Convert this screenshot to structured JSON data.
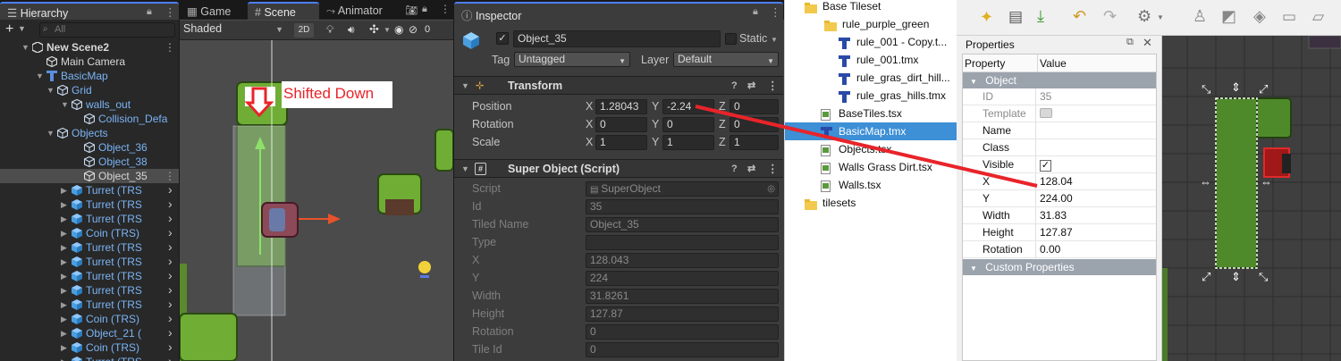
{
  "hierarchy": {
    "tab": "Hierarchy",
    "search_placeholder": "All",
    "rows": [
      {
        "label": "New Scene2"
      },
      {
        "label": "Main Camera"
      },
      {
        "label": "BasicMap"
      },
      {
        "label": "Grid"
      },
      {
        "label": "walls_out"
      },
      {
        "label": "Collision_Defa"
      },
      {
        "label": "Objects"
      },
      {
        "label": "Object_36"
      },
      {
        "label": "Object_38"
      },
      {
        "label": "Object_35"
      },
      {
        "label": "Turret (TRS"
      },
      {
        "label": "Turret (TRS"
      },
      {
        "label": "Turret (TRS"
      },
      {
        "label": "Coin (TRS)"
      },
      {
        "label": "Turret (TRS"
      },
      {
        "label": "Turret (TRS"
      },
      {
        "label": "Turret (TRS"
      },
      {
        "label": "Turret (TRS"
      },
      {
        "label": "Turret (TRS"
      },
      {
        "label": "Coin (TRS)"
      },
      {
        "label": "Object_21 ("
      },
      {
        "label": "Coin (TRS)"
      },
      {
        "label": "Turret (TRS"
      }
    ]
  },
  "scene": {
    "tabs": [
      "Game",
      "Scene",
      "Animator"
    ],
    "shading_mode": "Shaded",
    "mode_2d": "2D",
    "gizmo_count": "0",
    "annotation": "Shifted Down"
  },
  "inspector": {
    "tab": "Inspector",
    "object_name": "Object_35",
    "static_label": "Static",
    "tag_label": "Tag",
    "tag_value": "Untagged",
    "layer_label": "Layer",
    "layer_value": "Default",
    "transform": {
      "title": "Transform",
      "position_label": "Position",
      "rotation_label": "Rotation",
      "scale_label": "Scale",
      "position": {
        "x": "1.28043",
        "y": "-2.24",
        "z": "0"
      },
      "rotation": {
        "x": "0",
        "y": "0",
        "z": "0"
      },
      "scale": {
        "x": "1",
        "y": "1",
        "z": "1"
      },
      "axis_x": "X",
      "axis_y": "Y",
      "axis_z": "Z"
    },
    "super_object": {
      "title": "Super Object (Script)",
      "fields": [
        {
          "label": "Script",
          "value": "SuperObject"
        },
        {
          "label": "Id",
          "value": "35"
        },
        {
          "label": "Tiled Name",
          "value": "Object_35"
        },
        {
          "label": "Type",
          "value": ""
        },
        {
          "label": "X",
          "value": "128.043"
        },
        {
          "label": "Y",
          "value": "224"
        },
        {
          "label": "Width",
          "value": "31.8261"
        },
        {
          "label": "Height",
          "value": "127.87"
        },
        {
          "label": "Rotation",
          "value": "0"
        },
        {
          "label": "Tile Id",
          "value": "0"
        }
      ]
    }
  },
  "project_tree": {
    "items": [
      {
        "label": "Base Tileset"
      },
      {
        "label": "rule_purple_green"
      },
      {
        "label": "rule_001 - Copy.t..."
      },
      {
        "label": "rule_001.tmx"
      },
      {
        "label": "rule_gras_dirt_hill..."
      },
      {
        "label": "rule_gras_hills.tmx"
      },
      {
        "label": "BaseTiles.tsx"
      },
      {
        "label": "BasicMap.tmx"
      },
      {
        "label": "Objects.tsx"
      },
      {
        "label": "Walls Grass Dirt.tsx"
      },
      {
        "label": "Walls.tsx"
      },
      {
        "label": "tilesets"
      }
    ]
  },
  "properties": {
    "title": "Properties",
    "col_property": "Property",
    "col_value": "Value",
    "group_object": "Object",
    "rows": [
      {
        "name": "ID",
        "value": "35"
      },
      {
        "name": "Template",
        "value": ""
      },
      {
        "name": "Name",
        "value": ""
      },
      {
        "name": "Class",
        "value": ""
      },
      {
        "name": "Visible",
        "value": "✓"
      },
      {
        "name": "X",
        "value": "128.04"
      },
      {
        "name": "Y",
        "value": "224.00"
      },
      {
        "name": "Width",
        "value": "31.83"
      },
      {
        "name": "Height",
        "value": "127.87"
      },
      {
        "name": "Rotation",
        "value": "0.00"
      }
    ],
    "group_custom": "Custom Properties"
  },
  "colors": {
    "accent_blue": "#4c7fff",
    "selection_blue": "#3d8fd6",
    "annotation_red": "#e8242a",
    "grass_green": "#6ea83a"
  }
}
